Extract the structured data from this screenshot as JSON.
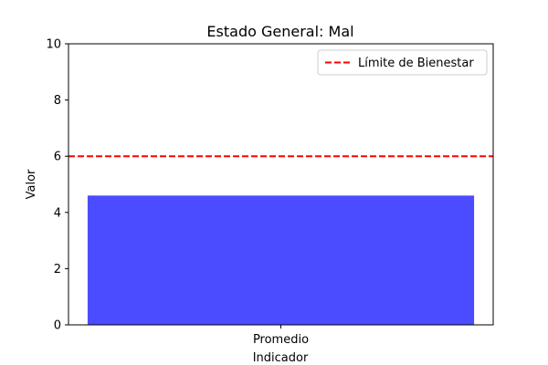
{
  "chart_data": {
    "type": "bar",
    "title": "Estado General: Mal",
    "xlabel": "Indicador",
    "ylabel": "Valor",
    "categories": [
      "Promedio"
    ],
    "values": [
      4.6
    ],
    "ylim": [
      0,
      10
    ],
    "yticks": [
      "0",
      "2",
      "4",
      "6",
      "8",
      "10"
    ],
    "grid": false,
    "bar_color": "#4b4bff",
    "reference_line": {
      "label": "Límite de Bienestar",
      "value": 6,
      "color": "#ff0000",
      "style": "dashed"
    },
    "legend": {
      "placement": "top-right",
      "entries": [
        "Límite de Bienestar"
      ]
    }
  }
}
